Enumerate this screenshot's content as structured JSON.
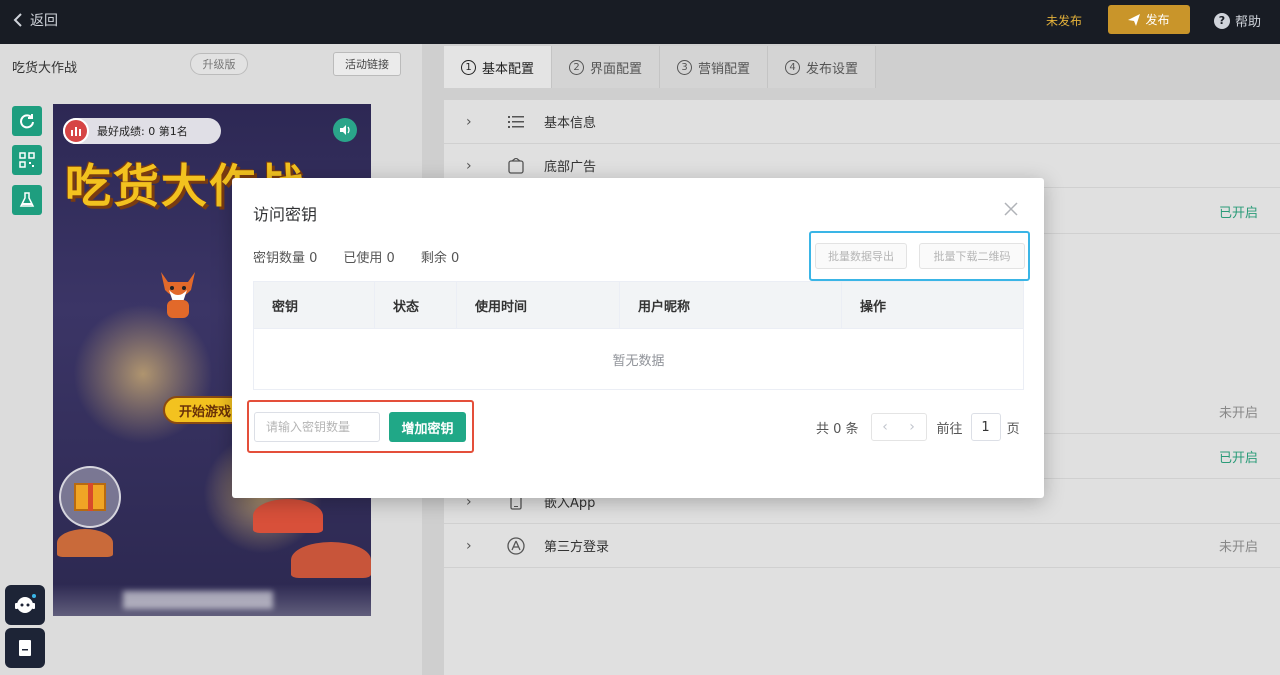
{
  "topbar": {
    "back_label": "返回",
    "status": "未发布",
    "publish_label": "发布",
    "help_label": "帮助"
  },
  "left": {
    "app_name": "吃货大作战",
    "upgrade_label": "升级版",
    "activity_link_label": "活动链接",
    "tools": [
      "refresh-icon",
      "qrcode-icon",
      "flask-icon"
    ]
  },
  "phone": {
    "best_score": "最好成绩: 0 第1名",
    "game_title": "吃货大作战",
    "start_label": "开始游戏"
  },
  "tabs": [
    {
      "num": "1",
      "label": "基本配置"
    },
    {
      "num": "2",
      "label": "界面配置"
    },
    {
      "num": "3",
      "label": "营销配置"
    },
    {
      "num": "4",
      "label": "发布设置"
    }
  ],
  "settings_rows": [
    {
      "label": "基本信息",
      "icon": "list-icon",
      "status": ""
    },
    {
      "label": "底部广告",
      "icon": "ad-icon",
      "status": ""
    },
    {
      "label": "",
      "icon": "",
      "status": "已开启",
      "status_on": true
    },
    {
      "label": "",
      "icon": "",
      "status": "未开启",
      "status_on": false
    },
    {
      "label": "",
      "icon": "",
      "status": "已开启",
      "status_on": true
    },
    {
      "label": "嵌入App",
      "icon": "phone-icon",
      "status": ""
    },
    {
      "label": "第三方登录",
      "icon": "app-store-icon",
      "status": "未开启",
      "status_on": false
    }
  ],
  "modal": {
    "title": "访问密钥",
    "stats": {
      "total": "密钥数量 0",
      "used": "已使用 0",
      "remaining": "剩余 0"
    },
    "export_label": "批量数据导出",
    "download_qr_label": "批量下载二维码",
    "columns": [
      "密钥",
      "状态",
      "使用时间",
      "用户昵称",
      "操作"
    ],
    "empty_text": "暂无数据",
    "input_placeholder": "请输入密钥数量",
    "add_label": "增加密钥",
    "pager": {
      "total": "共 0 条",
      "goto": "前往",
      "page": "1",
      "suffix": "页"
    }
  },
  "colors": {
    "accent": "#20a887",
    "publish": "#c9952a",
    "highlight_blue": "#3ab5e6",
    "highlight_red": "#e44f3a"
  }
}
